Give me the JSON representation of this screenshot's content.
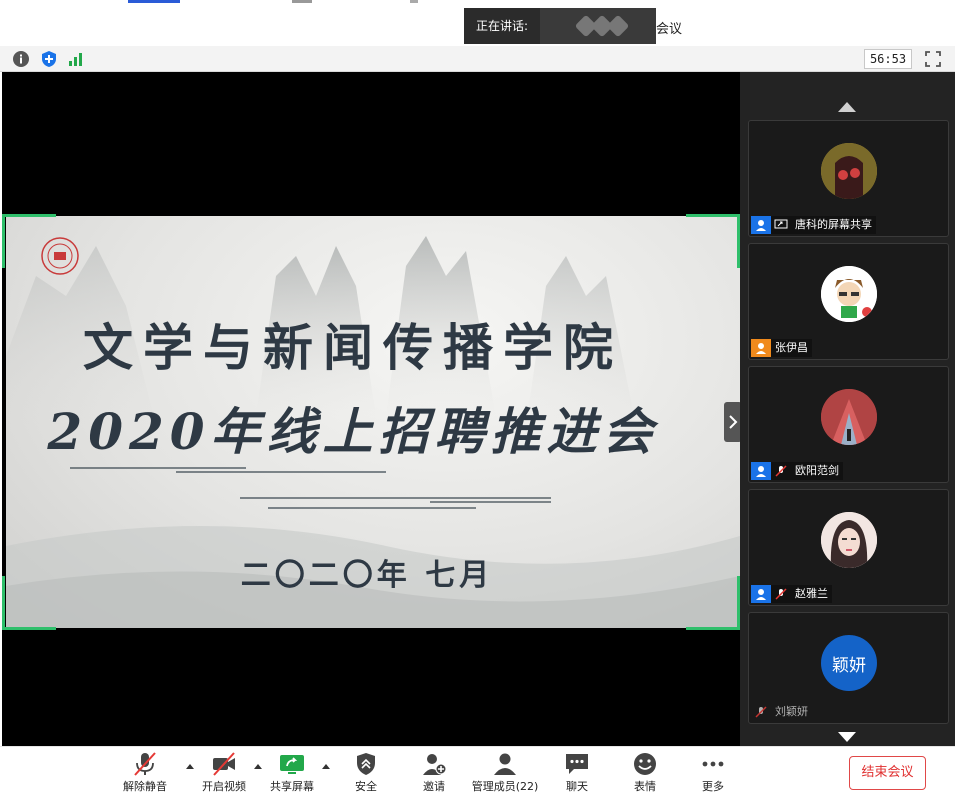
{
  "titlebar": {
    "speaking_prefix": "正在讲话:",
    "meeting_suffix": "会议"
  },
  "infobar": {
    "timer": "56:53",
    "icons": [
      "info-icon",
      "shield-icon",
      "signal-icon",
      "fullscreen-icon"
    ]
  },
  "slide": {
    "title_line1": "文学与新闻传播学院",
    "title_line2": "2020年线上招聘推进会",
    "date": "二〇二〇年 七月"
  },
  "participants": [
    {
      "name": "唐科的屏幕共享",
      "tag": "share",
      "avatar_color": "#b89a3a"
    },
    {
      "name": "张伊昌",
      "tag": "host",
      "avatar_color": "#ffffff"
    },
    {
      "name": "欧阳范剑",
      "tag": "muted",
      "avatar_color": "#a83838"
    },
    {
      "name": "赵雅兰",
      "tag": "muted",
      "avatar_color": "#e9d6d0"
    },
    {
      "name": "刘颖妍",
      "tag": "muted-only",
      "avatar_text": "颖妍",
      "avatar_color": "#1463c8"
    }
  ],
  "controls": {
    "unmute": "解除静音",
    "start_video": "开启视频",
    "share_screen": "共享屏幕",
    "security": "安全",
    "invite": "邀请",
    "manage_members": "管理成员(22)",
    "chat": "聊天",
    "reactions": "表情",
    "more": "更多",
    "end_meeting": "结束会议"
  },
  "colors": {
    "accent_green": "#2fbf6b",
    "end_red": "#e03030",
    "stage_bg": "#000000",
    "gallery_bg": "#232323"
  }
}
